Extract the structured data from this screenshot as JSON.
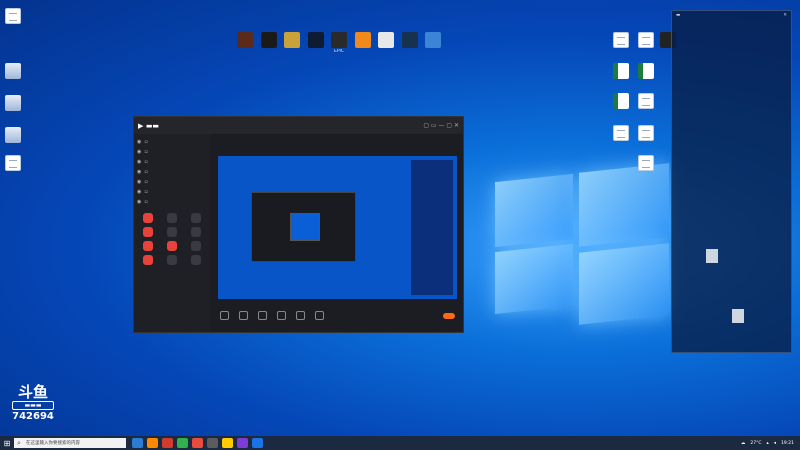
{
  "desktop": {
    "left_icons": [
      {
        "label": "",
        "kind": "doc"
      },
      {
        "label": "",
        "kind": "sys"
      },
      {
        "label": "",
        "kind": "sys"
      },
      {
        "label": "",
        "kind": "sys"
      },
      {
        "label": "",
        "kind": "doc"
      }
    ],
    "top_icons": [
      {
        "label": "",
        "color": "#5a2b1a"
      },
      {
        "label": "",
        "color": "#1a1a1a"
      },
      {
        "label": "",
        "color": "#c9a23a"
      },
      {
        "label": "",
        "color": "#0d1b33"
      },
      {
        "label": "EPIC",
        "color": "#2a2a2a"
      },
      {
        "label": "",
        "color": "#f08a1c"
      },
      {
        "label": "",
        "color": "#e8e8e8"
      },
      {
        "label": "",
        "color": "#17324f"
      },
      {
        "label": "",
        "color": "#3c84d8"
      }
    ],
    "right_icons": [
      {
        "kind": "doc"
      },
      {
        "kind": "doc"
      },
      {
        "kind": "app"
      },
      {
        "kind": "xls"
      },
      {
        "kind": "xls"
      },
      {
        "kind": "xls"
      },
      {
        "kind": "doc"
      },
      {
        "kind": "doc"
      },
      {
        "kind": "doc"
      },
      {
        "kind": "doc"
      }
    ]
  },
  "app_window": {
    "tabs": [
      "",
      "",
      ""
    ],
    "stream_title": "",
    "tag": "",
    "scenes": [
      "",
      "",
      "",
      "",
      "",
      "",
      ""
    ],
    "tools": [
      {
        "label": "",
        "hot": true
      },
      {
        "label": "",
        "hot": false
      },
      {
        "label": "",
        "hot": false
      },
      {
        "label": "",
        "hot": true
      },
      {
        "label": "",
        "hot": false
      },
      {
        "label": "",
        "hot": false
      },
      {
        "label": "",
        "hot": true
      },
      {
        "label": "",
        "hot": true
      },
      {
        "label": "",
        "hot": false
      },
      {
        "label": "",
        "hot": true
      },
      {
        "label": "",
        "hot": false
      },
      {
        "label": "",
        "hot": false
      }
    ],
    "controls": [
      "",
      "",
      "",
      "",
      "",
      ""
    ],
    "live_button": ""
  },
  "side_panel": {
    "tabs": [
      "",
      "",
      ""
    ],
    "messages": [
      "",
      ""
    ]
  },
  "watermark": {
    "brand": "斗鱼",
    "room_id": "742694"
  },
  "taskbar": {
    "search_placeholder": "在这里输入你要搜索的内容",
    "weather": "27°C",
    "time": "19:21",
    "colors": [
      "#2b7cd3",
      "#ff8a00",
      "#d23c2e",
      "#2fb24c",
      "#e74c3c",
      "#5c5c5c",
      "#ffcc00",
      "#7d3cd3",
      "#1a73e8"
    ]
  }
}
